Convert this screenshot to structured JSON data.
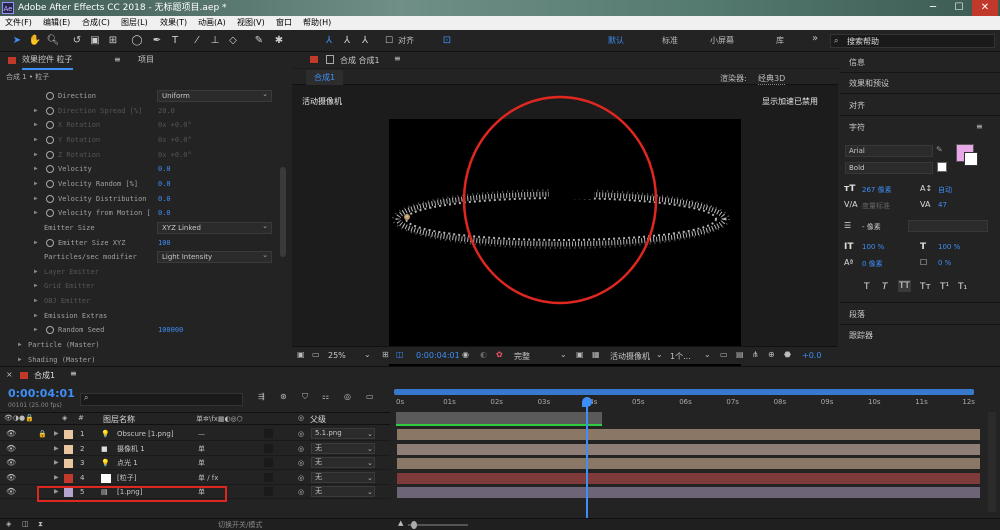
{
  "window": {
    "title": "Adobe After Effects CC 2018 - 无标题项目.aep *",
    "icon_text": "Ae",
    "minimize": "─",
    "maximize": "☐",
    "close": "✕"
  },
  "menu": [
    "文件(F)",
    "编辑(E)",
    "合成(C)",
    "图层(L)",
    "效果(T)",
    "动画(A)",
    "视图(V)",
    "窗口",
    "帮助(H)"
  ],
  "toolbar": {
    "snap_label": "对齐",
    "workspaces": [
      "默认",
      "标准",
      "小屏幕",
      "库"
    ],
    "active_workspace": "默认",
    "search_placeholder": "搜索帮助",
    "more": "»"
  },
  "effects_panel": {
    "title": "效果控件 粒子",
    "project_tab": "项目",
    "breadcrumb": "合成 1 • 粒子",
    "rows": [
      {
        "label": "Direction",
        "type": "dropdown",
        "value": "Uniform",
        "stopwatch": true,
        "dim": false
      },
      {
        "label": "Direction Spread [%]",
        "value": "20.0",
        "dim": true
      },
      {
        "label": "X Rotation",
        "value": "0x +0.0°",
        "dim": true
      },
      {
        "label": "Y Rotation",
        "value": "0x +0.0°",
        "dim": true
      },
      {
        "label": "Z Rotation",
        "value": "0x +0.0°",
        "dim": true
      },
      {
        "label": "Velocity",
        "value": "0.0",
        "dim": false
      },
      {
        "label": "Velocity Random [%]",
        "value": "0.0",
        "dim": false
      },
      {
        "label": "Velocity Distribution",
        "value": "0.0",
        "dim": false
      },
      {
        "label": "Velocity from Motion [",
        "value": "0.0",
        "dim": false
      },
      {
        "label": "Emitter Size",
        "type": "dropdown",
        "value": "XYZ Linked",
        "dim": false
      },
      {
        "label": "Emitter Size XYZ",
        "value": "100",
        "dim": false
      },
      {
        "label": "Particles/sec modifier",
        "type": "dropdown",
        "value": "Light Intensity",
        "dim": false
      },
      {
        "label": "Layer Emitter",
        "value": "",
        "dim": true
      },
      {
        "label": "Grid Emitter",
        "value": "",
        "dim": true
      },
      {
        "label": "OBJ Emitter",
        "value": "",
        "dim": true
      },
      {
        "label": "Emission Extras",
        "value": "",
        "dim": false
      },
      {
        "label": "Random Seed",
        "value": "100000",
        "dim": false
      },
      {
        "label": "Particle (Master)",
        "value": "",
        "dim": false
      },
      {
        "label": "Shading (Master)",
        "value": "",
        "dim": false
      }
    ]
  },
  "viewer": {
    "panel_title": "合成 合成1",
    "tab": "合成1",
    "renderer_label": "渲染器:",
    "renderer_value": "经典3D",
    "camera_label": "活动摄像机",
    "accel_note": "显示加速已禁用",
    "zoom": "25%",
    "timecode": "0:00:04:01",
    "quality": "完整",
    "view": "活动摄像机",
    "views_count": "1个...",
    "exposure": "+0.0"
  },
  "right_panel": {
    "items": [
      "信息",
      "效果和预设",
      "对齐",
      "字符"
    ],
    "font": "Arial",
    "style": "Bold",
    "font_size": "267 像素",
    "leading": "自动",
    "tracking_label": "度量标准",
    "tracking": "47",
    "stroke": "- 像素",
    "vscale": "100 %",
    "hscale": "100 %",
    "baseline": "0 像素",
    "tsume": "0 %",
    "typestyles": [
      "T",
      "T",
      "TT",
      "Tт",
      "T¹",
      "T₁"
    ],
    "fill_color": "#e8a8e8",
    "bottom_items": [
      "段落",
      "跟踪器"
    ]
  },
  "timeline": {
    "comp_tab": "合成1",
    "timecode": "0:00:04:01",
    "frames": "00101 (25.00 fps)",
    "col_layer_name": "图层名称",
    "col_parent": "父级",
    "ruler": [
      "0s",
      "01s",
      "02s",
      "03s",
      "04s",
      "05s",
      "06s",
      "07s",
      "08s",
      "09s",
      "10s",
      "11s",
      "12s"
    ],
    "switch_mode": "切换开关/模式",
    "layers": [
      {
        "num": "1",
        "name": "Obscure [1.png]",
        "icon": "light",
        "color": "#e7c6a0",
        "switch": "—",
        "parent": "5.1.png",
        "bar": "#8a7766"
      },
      {
        "num": "2",
        "name": "摄像机 1",
        "icon": "camera",
        "color": "#e7c6a0",
        "switch": "单",
        "parent": "无",
        "bar": "#8e7e76"
      },
      {
        "num": "3",
        "name": "点光 1",
        "icon": "light",
        "color": "#e7c6a0",
        "switch": "单",
        "parent": "无",
        "bar": "#8a7766"
      },
      {
        "num": "4",
        "name": "[粒子]",
        "icon": "solid",
        "color": "#c0392b",
        "switch": "单 / fx",
        "parent": "无",
        "bar": "#7f3a3a"
      },
      {
        "num": "5",
        "name": "[1.png]",
        "icon": "footage",
        "color": "#b5a2cd",
        "switch": "单",
        "parent": "无",
        "bar": "#6d6477"
      }
    ]
  }
}
